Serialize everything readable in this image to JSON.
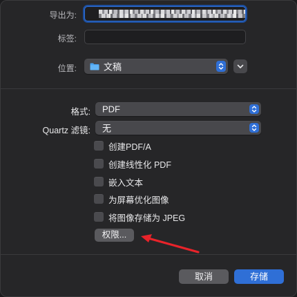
{
  "export": {
    "label": "导出为:",
    "value": ""
  },
  "tags": {
    "label": "标签:",
    "value": ""
  },
  "location": {
    "label": "位置:",
    "value": "文稿"
  },
  "format": {
    "label": "格式:",
    "value": "PDF"
  },
  "quartz": {
    "label": "Quartz 滤镜:",
    "value": "无"
  },
  "options": [
    {
      "label": "创建PDF/A",
      "checked": false
    },
    {
      "label": "创建线性化 PDF",
      "checked": false
    },
    {
      "label": "嵌入文本",
      "checked": false
    },
    {
      "label": "为屏幕优化图像",
      "checked": false
    },
    {
      "label": "将图像存储为 JPEG",
      "checked": false
    }
  ],
  "permissions_button": "权限...",
  "cancel_button": "取消",
  "save_button": "存储",
  "colors": {
    "accent": "#2f6fd6",
    "annotation_arrow": "#e8232a"
  }
}
